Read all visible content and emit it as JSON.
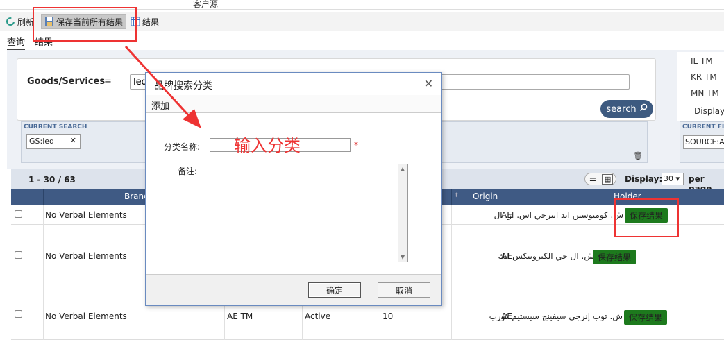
{
  "top": {
    "column_title": "客户源"
  },
  "toolbar": {
    "refresh_label": "刷新",
    "save_all_label": "保存当前所有结果",
    "result_label": "结果"
  },
  "tabs": [
    {
      "label": "查询"
    },
    {
      "label": "结果"
    }
  ],
  "search": {
    "field_label": "Goods/Services",
    "operator": "=",
    "value": "led",
    "button_label": "search"
  },
  "right_list": {
    "items": [
      "IL TM",
      "KR TM",
      "MN TM"
    ],
    "display_label": "Display:"
  },
  "current_search": {
    "label": "CURRENT SEARCH",
    "tag": "GS:led"
  },
  "current_filter": {
    "label": "CURRENT FILTERS",
    "tag": "SOURCE:AE"
  },
  "results": {
    "count": "1 - 30 / 63",
    "display_label": "Display:",
    "display_value": "30",
    "per_page_label": "per page"
  },
  "table": {
    "headers": [
      "Brand",
      "Origin",
      "Holder"
    ],
    "rows": [
      {
        "brand": "No Verbal Elements",
        "col3": "",
        "col4": "",
        "col5": "",
        "origin": "AE",
        "holder": "ش. كومبوستن اند اينرجي اس. ار. ال",
        "action": "保存结果"
      },
      {
        "brand": "No Verbal Elements",
        "col3": "",
        "col4": "",
        "col5": "",
        "origin": "AE",
        "holder": "ش. ال جي الكترونيكس انك",
        "action": "保存结果"
      },
      {
        "brand": "No Verbal Elements",
        "col3": "AE TM",
        "col4": "Active",
        "col5": "10",
        "origin": "AE",
        "holder": "ش. توب إنرجي سيفينج سيستيم كورب",
        "action": "保存结果"
      }
    ]
  },
  "modal": {
    "title": "品牌搜索分类",
    "add_label": "添加",
    "name_label": "分类名称:",
    "name_value": "",
    "required_mark": "*",
    "remark_label": "备注:",
    "remark_value": "",
    "ok_label": "确定",
    "cancel_label": "取消"
  },
  "annotation": {
    "hint_text": "输入分类",
    "color": "#ee3333"
  }
}
